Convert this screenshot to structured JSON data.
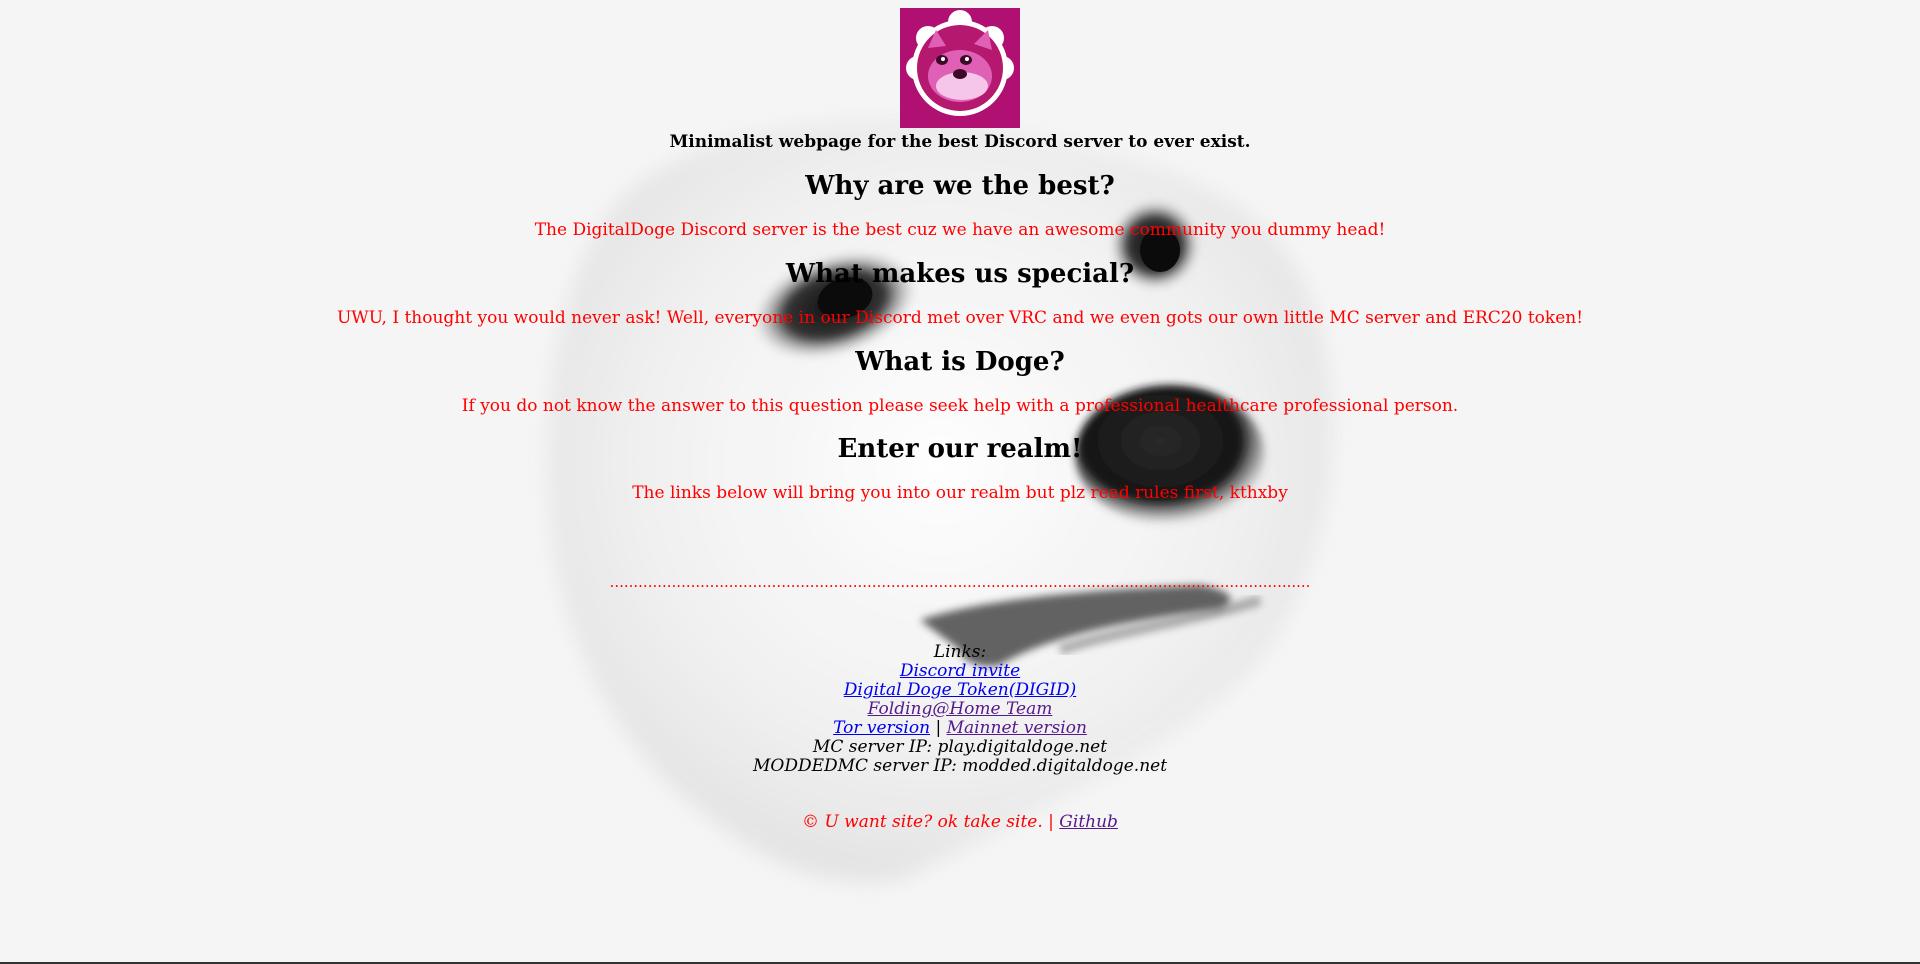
{
  "tagline": "Minimalist webpage for the best Discord server to ever exist.",
  "sections": [
    {
      "heading": "Why are we the best?",
      "text": "The DigitalDoge Discord server is the best cuz we have an awesome community you dummy head!"
    },
    {
      "heading": "What makes us special?",
      "text": "UWU, I thought you would never ask! Well, everyone in our Discord met over VRC and we even gots our own little MC server and ERC20 token!"
    },
    {
      "heading": "What is Doge?",
      "text": "If you do not know the answer to this question please seek help with a professional healthcare professional person."
    },
    {
      "heading": "Enter our realm!",
      "text": "The links below will bring you into our realm but plz read rules first, kthxby"
    }
  ],
  "divider": "...................................................................................................................................................",
  "links": {
    "label": "Links:",
    "discord": "Discord invite",
    "token": "Digital Doge Token(DIGID)",
    "folding": "Folding@Home Team",
    "tor": "Tor version",
    "separator": "|",
    "mainnet": "Mainnet version",
    "mc_server": "MC server IP: play.digitaldoge.net",
    "modded_server": "MODDEDMC server IP: modded.digitaldoge.net"
  },
  "footer": {
    "text": "© U want site? ok take site. |",
    "github": "Github"
  },
  "colors": {
    "background": "#f5f5f5",
    "accent_text": "#ff0000",
    "link": "#0000ee",
    "visited_link": "#551a8b",
    "logo_bg": "#c2157f"
  },
  "icons": {
    "logo": "doge-logo-icon",
    "background": "doge-face-background"
  }
}
